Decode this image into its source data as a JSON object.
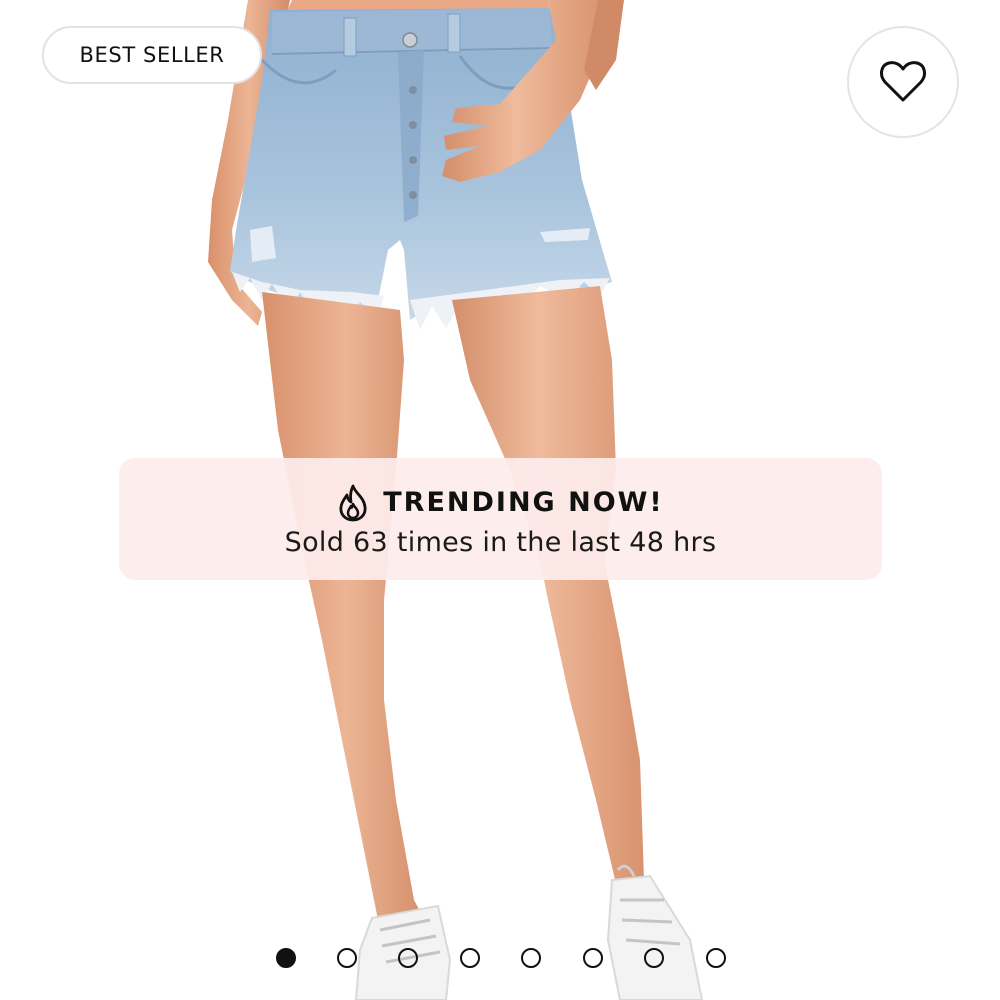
{
  "product_gallery": {
    "badge_label": "BEST SELLER",
    "favorite_icon": "heart-outline-icon",
    "trending": {
      "icon": "flame-icon",
      "title": "TRENDING NOW!",
      "subtitle": "Sold 63 times in the last 48 hrs"
    },
    "pagination": {
      "total": 8,
      "active_index": 0
    }
  },
  "colors": {
    "overlay_background": "#fdecec",
    "text": "#111111",
    "denim": "#a9c3dc",
    "skin": "#e3a883"
  }
}
